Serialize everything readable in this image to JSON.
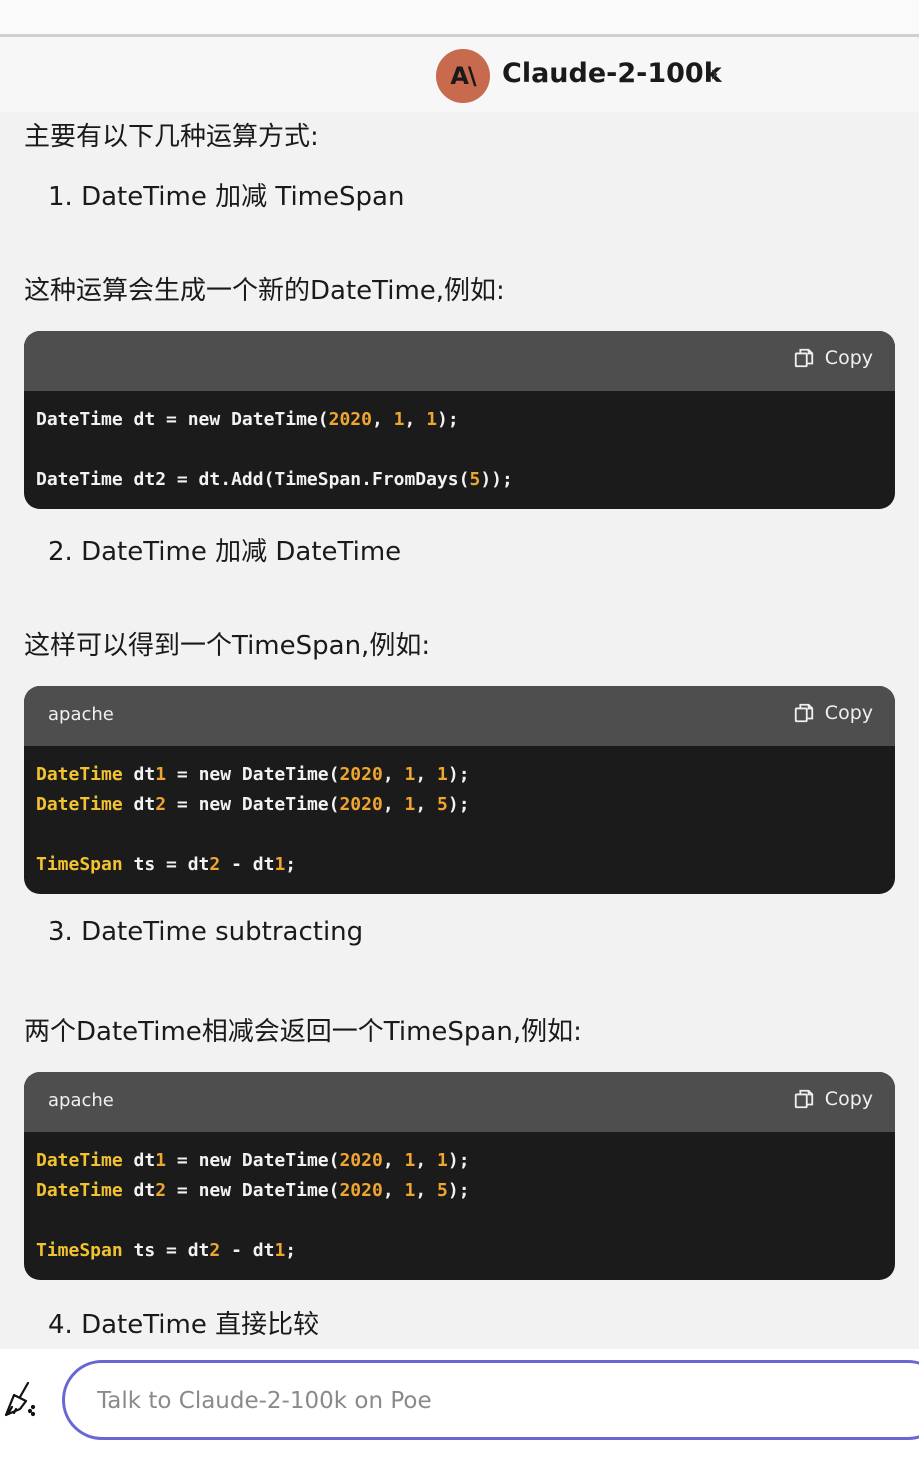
{
  "header": {
    "avatar_text": "A\\",
    "bot_name": "Claude-2-100k",
    "chevron": "›"
  },
  "message": {
    "intro": "主要有以下几种运算方式:",
    "items": [
      "1. DateTime 加减 TimeSpan",
      "2. DateTime 加减 DateTime",
      "3. DateTime subtracting",
      "4. DateTime 直接比较"
    ],
    "paras": [
      "这种运算会生成一个新的DateTime,例如:",
      "这样可以得到一个TimeSpan,例如:",
      "两个DateTime相减会返回一个TimeSpan,例如:"
    ],
    "code_blocks": [
      {
        "language": "",
        "copy_label": "Copy",
        "lines": [
          "DateTime dt = new DateTime(2020, 1, 1);",
          "",
          "DateTime dt2 = dt.Add(TimeSpan.FromDays(5));"
        ]
      },
      {
        "language": "apache",
        "copy_label": "Copy",
        "lines": [
          "DateTime dt1 = new DateTime(2020, 1, 1);",
          "DateTime dt2 = new DateTime(2020, 1, 5);",
          "",
          "TimeSpan ts = dt2 - dt1;"
        ]
      },
      {
        "language": "apache",
        "copy_label": "Copy",
        "lines": [
          "DateTime dt1 = new DateTime(2020, 1, 1);",
          "DateTime dt2 = new DateTime(2020, 1, 5);",
          "",
          "TimeSpan ts = dt2 - dt1;"
        ]
      }
    ]
  },
  "composer": {
    "placeholder": "Talk to Claude-2-100k on Poe"
  },
  "colors": {
    "accent": "#6a66d6",
    "avatar": "#c86a4e",
    "code_number": "#f0a530",
    "code_keyword": "#f2c230"
  }
}
